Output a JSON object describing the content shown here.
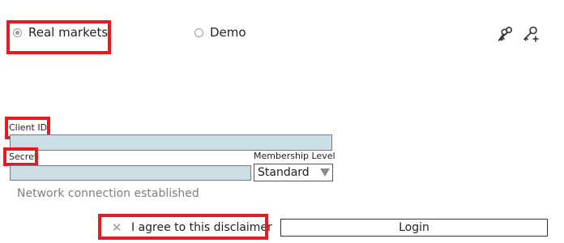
{
  "mode": {
    "real_label": "Real markets",
    "demo_label": "Demo",
    "selected": "real"
  },
  "icons": {
    "left": "keys-icon",
    "right": "add-key-icon"
  },
  "form": {
    "client_id_label": "Client ID",
    "client_id_value": "",
    "secret_label": "Secret",
    "secret_value": "",
    "membership_label": "Membership Level",
    "membership_value": "Standard"
  },
  "status": {
    "text": "Network connection established"
  },
  "disclaimer": {
    "label": "I agree to this disclaimer",
    "checked": false
  },
  "actions": {
    "login_label": "Login"
  },
  "colors": {
    "highlight": "#e31b23",
    "input_bg": "#ccdde6"
  }
}
